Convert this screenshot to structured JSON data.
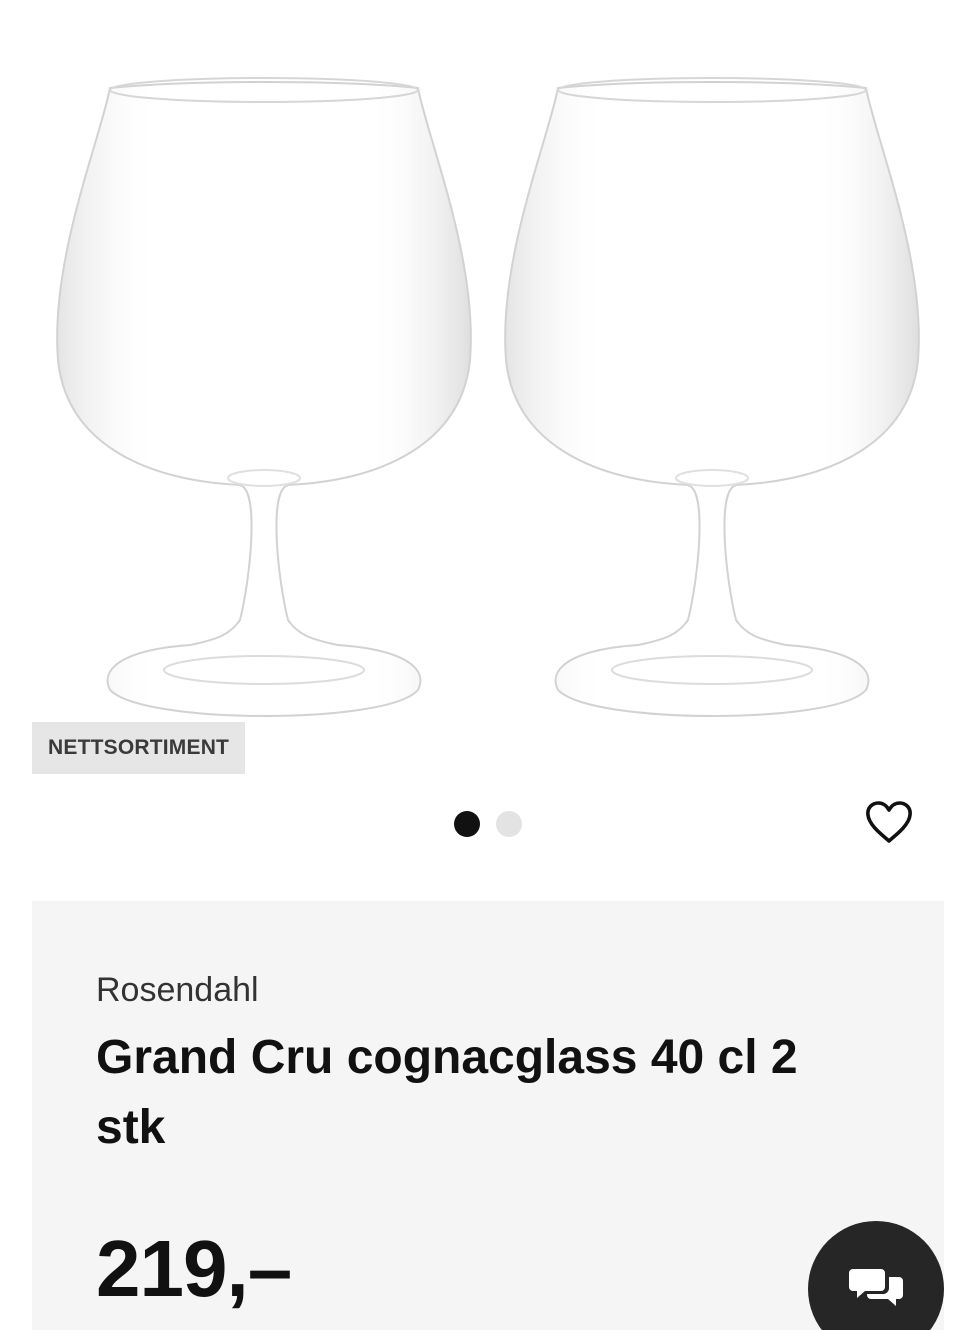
{
  "gallery": {
    "badge": "NETTSORTIMENT",
    "dots": [
      {
        "active": true
      },
      {
        "active": false
      }
    ]
  },
  "favorite": {
    "icon": "heart-outline-icon"
  },
  "product": {
    "brand": "Rosendahl",
    "title": "Grand Cru cognacglass 40 cl 2 stk",
    "price": "219,–"
  },
  "chat": {
    "icon": "chat-bubbles-icon"
  },
  "colors": {
    "background": "#ffffff",
    "card": "#f5f5f5",
    "badge": "#e6e6e6",
    "dot_active": "#111111",
    "dot_inactive": "#e3e3e3",
    "chat_button": "#262626"
  }
}
